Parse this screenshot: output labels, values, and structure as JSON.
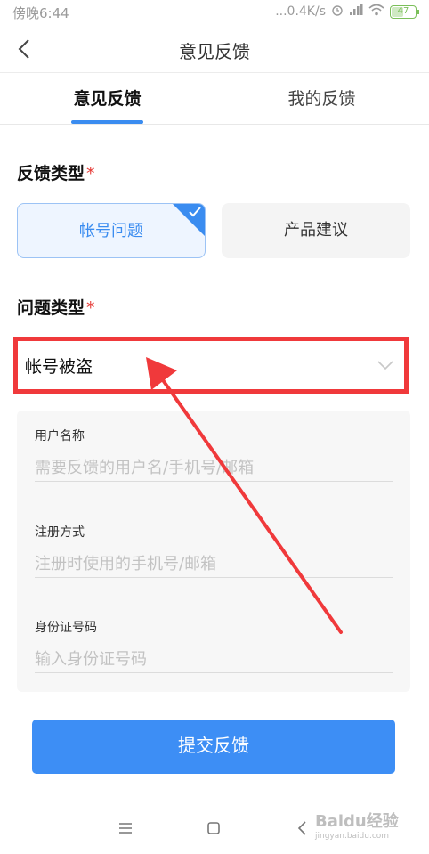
{
  "status_bar": {
    "time": "傍晚6:44",
    "network_speed": "...0.4K/s",
    "battery_level": "47",
    "battery_fraction": 0.47
  },
  "nav": {
    "title": "意见反馈",
    "back_icon": "chevron-left-icon"
  },
  "tabs": [
    {
      "label": "意见反馈",
      "active": true
    },
    {
      "label": "我的反馈",
      "active": false
    }
  ],
  "feedback_type": {
    "label": "反馈类型",
    "required_mark": "*",
    "options": [
      {
        "label": "帐号问题",
        "selected": true
      },
      {
        "label": "产品建议",
        "selected": false
      }
    ]
  },
  "issue_type": {
    "label": "问题类型",
    "required_mark": "*",
    "selected_value": "帐号被盗",
    "icon": "chevron-down-icon"
  },
  "form": {
    "fields": [
      {
        "label": "用户名称",
        "placeholder": "需要反馈的用户名/手机号/邮箱",
        "value": ""
      },
      {
        "label": "注册方式",
        "placeholder": "注册时使用的手机号/邮箱",
        "value": ""
      },
      {
        "label": "身份证号码",
        "placeholder": "输入身份证号码",
        "value": ""
      }
    ]
  },
  "submit_label": "提交反馈",
  "colors": {
    "accent": "#3a8cf0",
    "highlight_box": "#f0393b",
    "required": "#e53935"
  },
  "watermark": {
    "brand": "Baidu经验",
    "url": "jingyan.baidu.com"
  }
}
